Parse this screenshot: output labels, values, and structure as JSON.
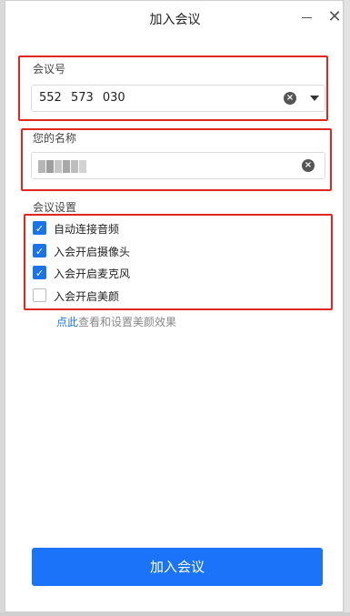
{
  "window": {
    "title": "加入会议"
  },
  "meeting_id": {
    "label": "会议号",
    "value": "552  573  030"
  },
  "name": {
    "label": "您的名称",
    "blur_colors": [
      "#b5b5b5",
      "#9e9e9e",
      "#c6c6c6",
      "#a8a8a8",
      "#bdbdbd",
      "#d2d2d2"
    ]
  },
  "settings": {
    "label": "会议设置",
    "options": [
      {
        "label": "自动连接音频",
        "checked": true
      },
      {
        "label": "入会开启摄像头",
        "checked": true
      },
      {
        "label": "入会开启麦克风",
        "checked": true
      },
      {
        "label": "入会开启美颜",
        "checked": false
      }
    ]
  },
  "hint": {
    "link": "点此",
    "text": "查看和设置美颜效果"
  },
  "join_button": {
    "label": "加入会议"
  },
  "colors": {
    "accent": "#1a73e8",
    "highlight": "#e0261f"
  }
}
